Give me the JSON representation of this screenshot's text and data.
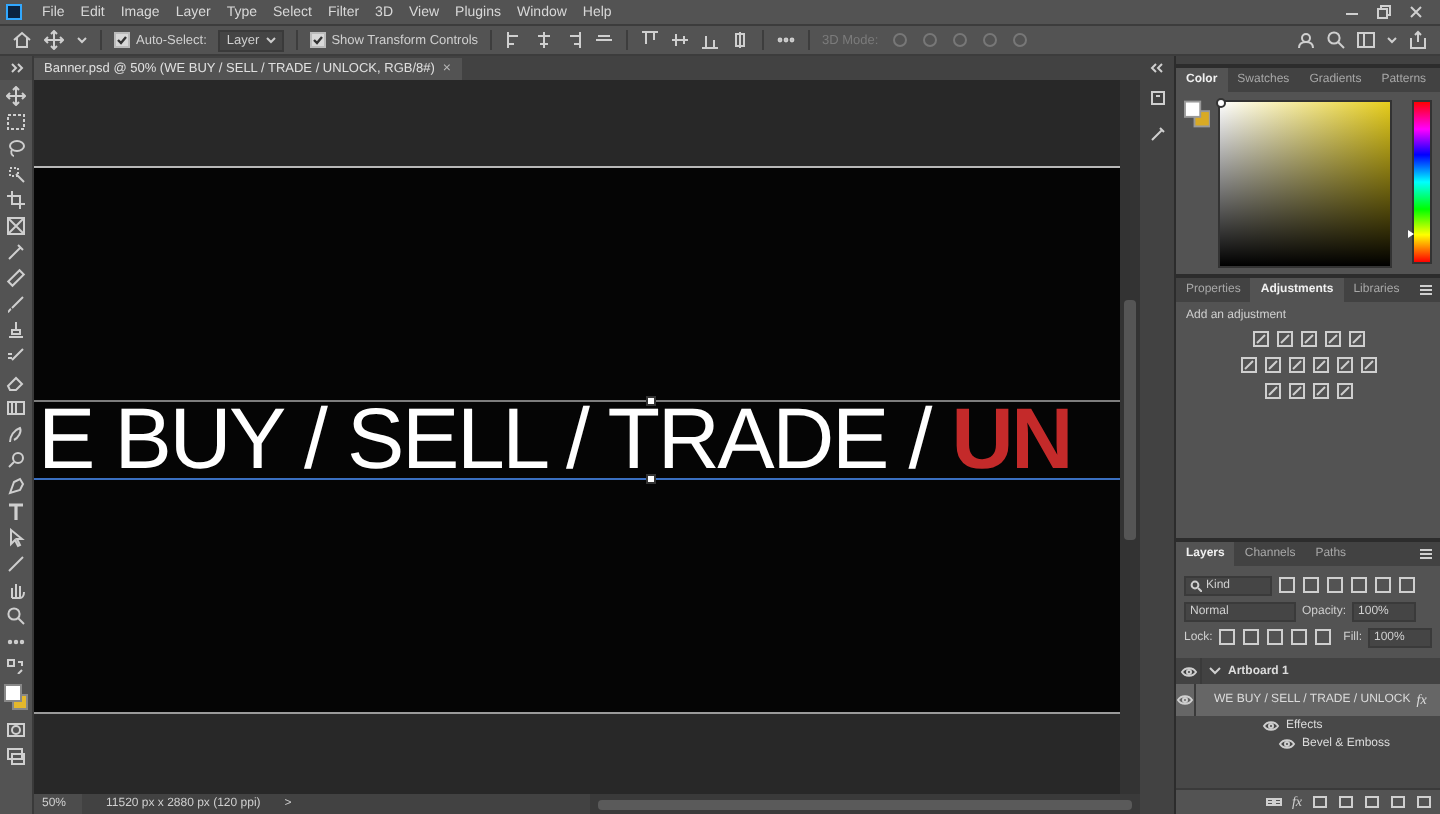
{
  "menu_bar": {
    "items": [
      "File",
      "Edit",
      "Image",
      "Layer",
      "Type",
      "Select",
      "Filter",
      "3D",
      "View",
      "Plugins",
      "Window",
      "Help"
    ]
  },
  "options_bar": {
    "auto_select": {
      "label": "Auto-Select:",
      "checked": true
    },
    "target": {
      "value": "Layer"
    },
    "transform_controls": {
      "label": "Show Transform Controls",
      "checked": true
    },
    "mode_label": "3D Mode:"
  },
  "document_tab": {
    "title": "Banner.psd @ 50% (WE BUY / SELL / TRADE / UNLOCK, RGB/8#)",
    "close": "×"
  },
  "canvas": {
    "text_runs": [
      {
        "text": "E BUY / SELL / TRADE / ",
        "kind": "plain",
        "color": "#ffffff"
      },
      {
        "text": "UN",
        "kind": "accent",
        "color": "#c42a2a"
      }
    ]
  },
  "color_panel": {
    "hue": {
      "level": 0.17
    },
    "tabs": [
      {
        "label": "Color",
        "selected": true
      },
      {
        "label": "Swatches",
        "selected": false
      },
      {
        "label": "Gradients",
        "selected": false
      },
      {
        "label": "Patterns",
        "selected": false
      }
    ]
  },
  "adjustments_panel": {
    "tabs": [
      {
        "label": "Properties",
        "selected": false
      },
      {
        "label": "Adjustments",
        "selected": true
      },
      {
        "label": "Libraries",
        "selected": false
      }
    ],
    "hint": "Add an adjustment"
  },
  "layers_panel": {
    "tabs": [
      {
        "label": "Layers",
        "selected": true
      },
      {
        "label": "Channels",
        "selected": false
      },
      {
        "label": "Paths",
        "selected": false
      }
    ],
    "filter": {
      "value": "Kind"
    },
    "blend_mode": {
      "value": "Normal"
    },
    "opacity": {
      "label": "Opacity:",
      "value": "100%"
    },
    "lock_label": "Lock:",
    "fill": {
      "label": "Fill:",
      "value": "100%"
    },
    "layers": [
      {
        "name": "Artboard 1",
        "kind": "group",
        "visible": true,
        "expanded": true,
        "selected": false,
        "children": [
          {
            "name": "WE BUY / SELL / TRADE / UNLOCK",
            "kind": "text",
            "visible": true,
            "selected": true,
            "badge": "fx",
            "children": [
              {
                "name": "Effects",
                "kind": "effects",
                "visible": true,
                "selected": false,
                "children": [
                  {
                    "name": "Bevel & Emboss",
                    "kind": "effect",
                    "visible": true,
                    "selected": false
                  }
                ]
              }
            ]
          }
        ]
      }
    ],
    "footer_fx": "fx"
  },
  "status_bar": {
    "zoom": "50%",
    "doc_info": "11520 px x 2880 px (120 ppi)",
    "arrow": ">"
  }
}
